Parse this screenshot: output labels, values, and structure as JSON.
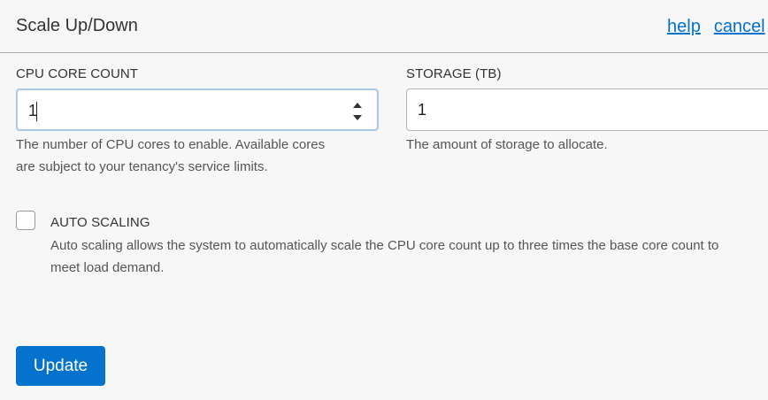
{
  "header": {
    "title": "Scale Up/Down",
    "help_link": "help",
    "cancel_link": "cancel"
  },
  "cpu": {
    "label": "CPU CORE COUNT",
    "value": "1",
    "help_line1": "The number of CPU cores to enable. Available cores",
    "help_line2": "are subject to your tenancy's service limits."
  },
  "storage": {
    "label": "STORAGE (TB)",
    "value": "1",
    "help": "The amount of storage to allocate."
  },
  "auto_scaling": {
    "label": "AUTO SCALING",
    "checked": false,
    "desc_line1": "Auto scaling allows the system to automatically scale the CPU core count up to three times the base core count to",
    "desc_line2": "meet load demand."
  },
  "footer": {
    "update_label": "Update"
  },
  "colors": {
    "accent": "#0572ce",
    "background": "#f7f7f7"
  }
}
